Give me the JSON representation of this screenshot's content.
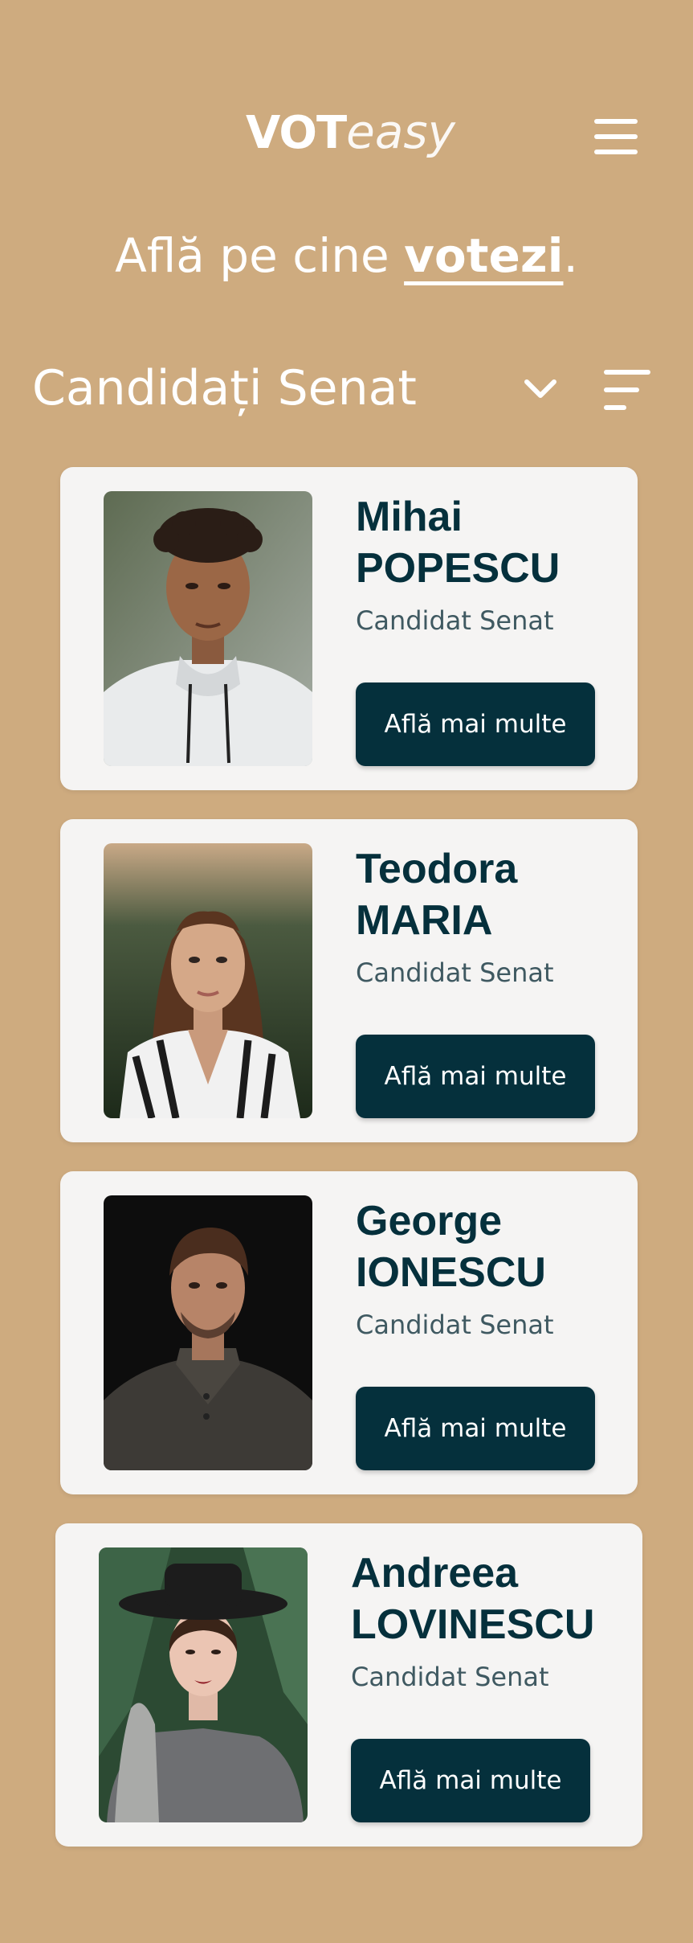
{
  "header": {
    "logo_bold": "VOT",
    "logo_light": "easy"
  },
  "tagline": {
    "prefix": "Află pe cine ",
    "accent": "votezi",
    "suffix": "."
  },
  "section": {
    "title": "Candidați Senat"
  },
  "icons": {
    "menu": "hamburger-menu-icon",
    "dropdown": "chevron-down-icon",
    "filter": "filter-lines-icon"
  },
  "colors": {
    "background": "#ceab7f",
    "card": "#f5f4f3",
    "primary": "#05303c"
  },
  "candidates": [
    {
      "first_name": "Mihai",
      "last_name": "POPESCU",
      "role": "Candidat Senat",
      "cta": "Află mai multe"
    },
    {
      "first_name": "Teodora",
      "last_name": "MARIA",
      "role": "Candidat Senat",
      "cta": "Află mai multe"
    },
    {
      "first_name": "George",
      "last_name": "IONESCU",
      "role": "Candidat Senat",
      "cta": "Află mai multe"
    },
    {
      "first_name": "Andreea",
      "last_name": "LOVINESCU",
      "role": "Candidat Senat",
      "cta": "Află mai multe"
    }
  ]
}
